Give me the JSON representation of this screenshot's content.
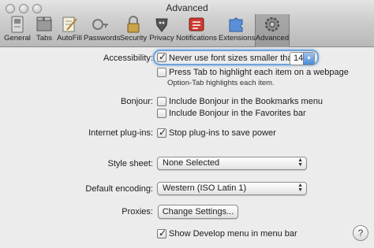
{
  "window": {
    "title": "Advanced"
  },
  "toolbar": {
    "items": [
      {
        "label": "General",
        "icon": "general-icon"
      },
      {
        "label": "Tabs",
        "icon": "tabs-icon"
      },
      {
        "label": "AutoFill",
        "icon": "autofill-icon"
      },
      {
        "label": "Passwords",
        "icon": "passwords-icon"
      },
      {
        "label": "Security",
        "icon": "security-icon"
      },
      {
        "label": "Privacy",
        "icon": "privacy-icon"
      },
      {
        "label": "Notifications",
        "icon": "notifications-icon"
      },
      {
        "label": "Extensions",
        "icon": "extensions-icon"
      },
      {
        "label": "Advanced",
        "icon": "advanced-icon",
        "selected": true
      }
    ]
  },
  "accessibility": {
    "label": "Accessibility:",
    "min_font_label": "Never use font sizes smaller than",
    "min_font_checked": true,
    "min_font_value": "14",
    "press_tab_label": "Press Tab to highlight each item on a webpage",
    "press_tab_checked": false,
    "hint": "Option-Tab highlights each item."
  },
  "bonjour": {
    "label": "Bonjour:",
    "bookmarks_menu_label": "Include Bonjour in the Bookmarks menu",
    "bookmarks_menu_checked": false,
    "favorites_bar_label": "Include Bonjour in the Favorites bar",
    "favorites_bar_checked": false
  },
  "plugins": {
    "label": "Internet plug-ins:",
    "stop_label": "Stop plug-ins to save power",
    "stop_checked": true
  },
  "style_sheet": {
    "label": "Style sheet:",
    "value": "None Selected"
  },
  "encoding": {
    "label": "Default encoding:",
    "value": "Western (ISO Latin 1)"
  },
  "proxies": {
    "label": "Proxies:",
    "button_label": "Change Settings..."
  },
  "develop": {
    "label": "Show Develop menu in menu bar",
    "checked": true
  },
  "help": {
    "label": "?"
  },
  "colors": {
    "focus_ring": "#6fa3d8",
    "selected_tab": "#9a9a9a"
  }
}
